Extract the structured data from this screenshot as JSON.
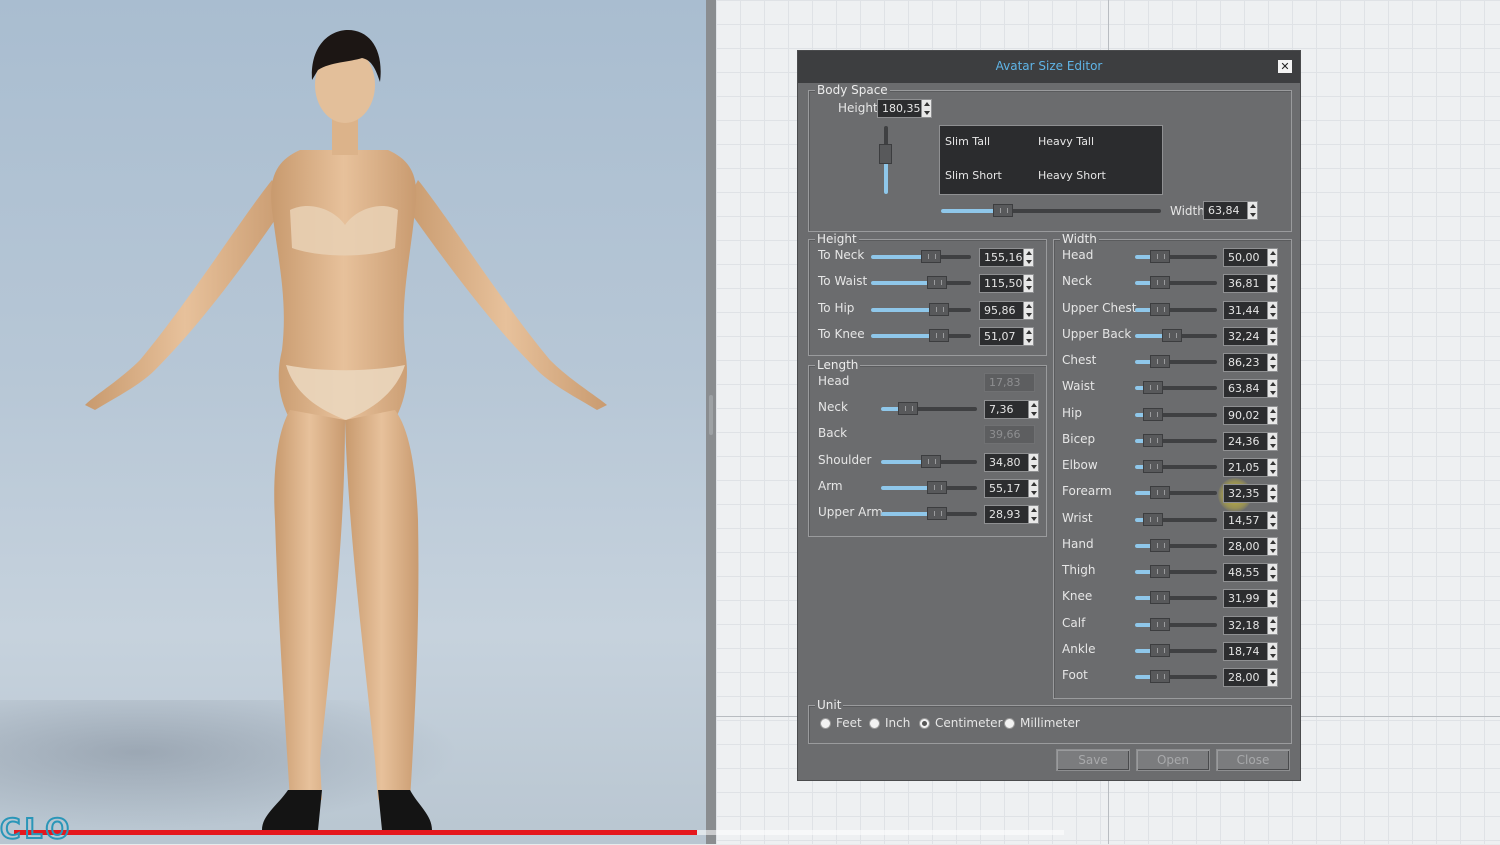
{
  "dialog": {
    "title": "Avatar Size Editor",
    "close_glyph": "✕",
    "body_space": {
      "legend": "Body Space",
      "height_label": "Height",
      "height_value": "180,35",
      "cells": [
        "Slim Tall",
        "Heavy Tall",
        "Slim Short",
        "Heavy Short"
      ],
      "width_label": "Width",
      "width_value": "63,84",
      "width_level": 0.28,
      "height_level": 0.6
    },
    "height_group": {
      "legend": "Height",
      "rows": [
        {
          "label": "To Neck",
          "value": "155,16",
          "level": 0.6
        },
        {
          "label": "To Waist",
          "value": "115,50",
          "level": 0.66
        },
        {
          "label": "To Hip",
          "value": "95,86",
          "level": 0.68
        },
        {
          "label": "To Knee",
          "value": "51,07",
          "level": 0.68
        }
      ]
    },
    "length_group": {
      "legend": "Length",
      "rows": [
        {
          "label": "Head",
          "value": "17,83",
          "readonly": true
        },
        {
          "label": "Neck",
          "value": "7,36",
          "level": 0.28
        },
        {
          "label": "Back",
          "value": "39,66",
          "readonly": true
        },
        {
          "label": "Shoulder",
          "value": "34,80",
          "level": 0.52
        },
        {
          "label": "Arm",
          "value": "55,17",
          "level": 0.58
        },
        {
          "label": "Upper Arm",
          "value": "28,93",
          "level": 0.58
        }
      ]
    },
    "width_group": {
      "legend": "Width",
      "rows": [
        {
          "label": "Head",
          "value": "50,00",
          "level": 0.3
        },
        {
          "label": "Neck",
          "value": "36,81",
          "level": 0.3
        },
        {
          "label": "Upper Chest",
          "value": "31,44",
          "level": 0.3
        },
        {
          "label": "Upper Back",
          "value": "32,24",
          "level": 0.45
        },
        {
          "label": "Chest",
          "value": "86,23",
          "level": 0.3
        },
        {
          "label": "Waist",
          "value": "63,84",
          "level": 0.22
        },
        {
          "label": "Hip",
          "value": "90,02",
          "level": 0.22
        },
        {
          "label": "Bicep",
          "value": "24,36",
          "level": 0.22
        },
        {
          "label": "Elbow",
          "value": "21,05",
          "level": 0.22
        },
        {
          "label": "Forearm",
          "value": "32,35",
          "level": 0.3
        },
        {
          "label": "Wrist",
          "value": "14,57",
          "level": 0.22
        },
        {
          "label": "Hand",
          "value": "28,00",
          "level": 0.3
        },
        {
          "label": "Thigh",
          "value": "48,55",
          "level": 0.3
        },
        {
          "label": "Knee",
          "value": "31,99",
          "level": 0.3
        },
        {
          "label": "Calf",
          "value": "32,18",
          "level": 0.3
        },
        {
          "label": "Ankle",
          "value": "18,74",
          "level": 0.3
        },
        {
          "label": "Foot",
          "value": "28,00",
          "level": 0.3
        }
      ]
    },
    "unit": {
      "legend": "Unit",
      "options": [
        "Feet",
        "Inch",
        "Centimeter",
        "Millimeter"
      ],
      "selected": "Centimeter"
    },
    "buttons": {
      "save": "Save",
      "open": "Open",
      "close": "Close"
    }
  },
  "video": {
    "progress": 0.65
  },
  "colors": {
    "accent": "#5fb4e6",
    "slider_fill": "#8fc7ea",
    "progress": "#e5171d"
  }
}
